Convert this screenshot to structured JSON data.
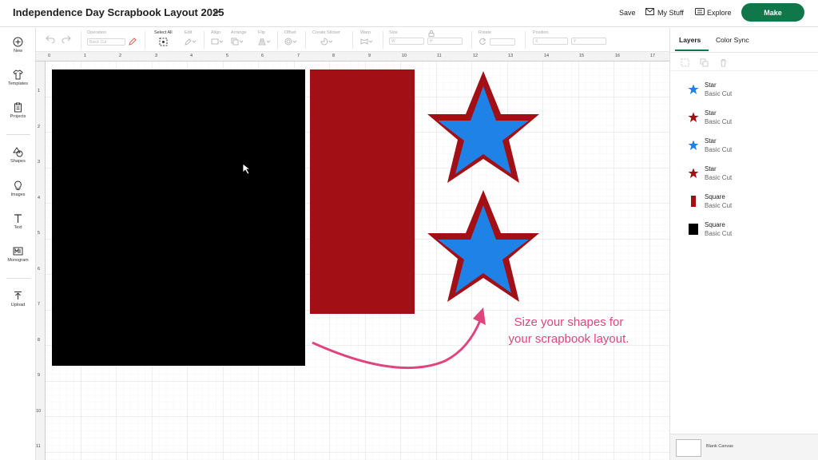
{
  "header": {
    "project_title": "Independence Day Scrapbook Layout 2025",
    "save_label": "Save",
    "my_stuff_label": "My Stuff",
    "explore_label": "Explore",
    "make_label": "Make"
  },
  "toolbar": {
    "operation_label": "Operation",
    "operation_value": "Basic Cut",
    "select_all_label": "Select All",
    "edit_label": "Edit",
    "align_label": "Align",
    "arrange_label": "Arrange",
    "flip_label": "Flip",
    "offset_label": "Offset",
    "create_sticker_label": "Create Sticker",
    "warp_label": "Warp",
    "size_label": "Size",
    "size_w": "W",
    "size_h": "H",
    "rotate_label": "Rotate",
    "position_label": "Position",
    "position_x": "X",
    "position_y": "Y"
  },
  "sidebar": {
    "items": [
      {
        "label": "New",
        "icon": "plus-circle-icon"
      },
      {
        "label": "Templates",
        "icon": "shirt-icon"
      },
      {
        "label": "Projects",
        "icon": "clipboard-icon"
      },
      {
        "label": "Shapes",
        "icon": "shapes-icon"
      },
      {
        "label": "Images",
        "icon": "lightbulb-icon"
      },
      {
        "label": "Text",
        "icon": "text-icon"
      },
      {
        "label": "Monogram",
        "icon": "monogram-icon"
      },
      {
        "label": "Upload",
        "icon": "upload-icon"
      }
    ]
  },
  "ruler": {
    "top": [
      "0",
      "1",
      "2",
      "3",
      "4",
      "5",
      "6",
      "7",
      "8",
      "9",
      "10",
      "11",
      "12",
      "13",
      "14",
      "15",
      "16",
      "17"
    ],
    "left": [
      "1",
      "2",
      "3",
      "4",
      "5",
      "6",
      "7",
      "8",
      "9",
      "10",
      "11"
    ]
  },
  "canvas": {
    "annotation_line1": "Size your shapes for",
    "annotation_line2": "your scrapbook layout."
  },
  "panel": {
    "tab_layers": "Layers",
    "tab_color_sync": "Color Sync",
    "layers": [
      {
        "name": "Star",
        "operation": "Basic Cut",
        "shape": "star",
        "color": "#1e82e6"
      },
      {
        "name": "Star",
        "operation": "Basic Cut",
        "shape": "star",
        "color": "#a20f14"
      },
      {
        "name": "Star",
        "operation": "Basic Cut",
        "shape": "star",
        "color": "#1e82e6"
      },
      {
        "name": "Star",
        "operation": "Basic Cut",
        "shape": "star",
        "color": "#a20f14"
      },
      {
        "name": "Square",
        "operation": "Basic Cut",
        "shape": "tall-rect",
        "color": "#a20f14"
      },
      {
        "name": "Square",
        "operation": "Basic Cut",
        "shape": "square",
        "color": "#000000"
      }
    ],
    "blank_canvas_label": "Blank Canvas"
  },
  "colors": {
    "accent": "#10774a",
    "star_blue": "#1e82e6",
    "red": "#a20f14",
    "black": "#000000",
    "annotation_pink": "#e0447c"
  }
}
